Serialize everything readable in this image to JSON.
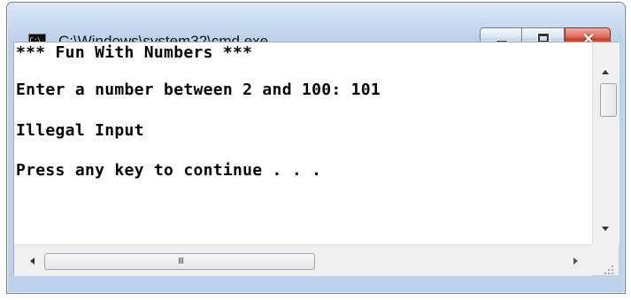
{
  "window": {
    "title": "C:\\Windows\\system32\\cmd.exe",
    "icon": "cmd-console-icon",
    "icon_text": "C:\\."
  },
  "console": {
    "lines": [
      "*** Fun With Numbers ***",
      "Enter a number between 2 and 100: 101",
      "Illegal Input",
      "Press any key to continue . . ."
    ]
  },
  "scrollbars": {
    "horizontal_thumb_label": "III"
  },
  "colors": {
    "console_background": "#ffffff",
    "console_text": "#000000",
    "close_button": "#d9533f",
    "frame": "#bcd1ea"
  }
}
